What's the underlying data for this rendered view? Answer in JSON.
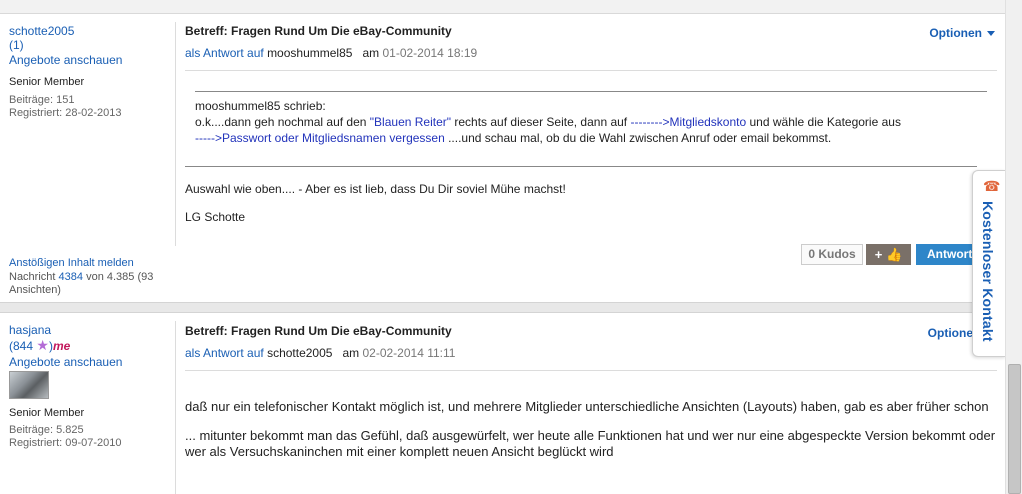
{
  "post1": {
    "author": {
      "username": "schotte2005",
      "rank": "(1)",
      "offers_link": "Angebote anschauen",
      "role": "Senior Member",
      "posts": "Beiträge: 151",
      "registered": "Registriert: 28-02-2013"
    },
    "subject": "Betreff: Fragen Rund Um Die eBay-Community",
    "reply_prefix": "als Antwort auf",
    "reply_to": "mooshummel85",
    "at": "am",
    "date": "01-02-2014 18:19",
    "options_label": "Optionen",
    "quote": {
      "header": "mooshummel85 schrieb:",
      "line1_a": "o.k....dann geh nochmal auf den ",
      "line1_link1": "\"Blauen Reiter\"",
      "line1_b": " rechts auf dieser Seite, dann auf ",
      "line1_link2": "-------->Mitgliedskonto",
      "line1_c": " und wähle die Kategorie aus",
      "line2_link": "----->Passwort oder Mitgliedsnamen vergessen",
      "line2_b": " ....und schau mal, ob du  die Wahl zwischen Anruf oder email bekommst."
    },
    "body": [
      "Auswahl wie oben....  - Aber es ist lieb, dass Du Dir soviel Mühe machst!",
      "LG Schotte"
    ],
    "footer": {
      "report": "Anstößigen Inhalt melden",
      "message_prefix": "Nachricht",
      "message_number": "4384",
      "message_suffix": "von 4.385 (93 Ansichten)"
    },
    "kudos_count": "0 Kudos",
    "kudos_plus": "+",
    "reply_label": "Antwort"
  },
  "post2": {
    "author": {
      "username": "hasjana",
      "rank_open": "(",
      "rank_link": "844",
      "rank_badge": "me",
      "offers_link": "Angebote anschauen",
      "role": "Senior Member",
      "posts": "Beiträge: 5.825",
      "registered": "Registriert: 09-07-2010"
    },
    "subject": "Betreff: Fragen Rund Um Die eBay-Community",
    "reply_prefix": "als Antwort auf",
    "reply_to": "schotte2005",
    "at": "am",
    "date": "02-02-2014 11:11",
    "options_label": "Optione",
    "body": [
      "daß nur ein telefonischer Kontakt möglich ist, und mehrere Mitglieder unterschiedliche Ansichten (Layouts) haben, gab es aber früher schon",
      "... mitunter bekommt man das Gefühl, daß ausgewürfelt, wer heute alle Funktionen hat und wer nur eine abgespeckte Version bekommt oder wer als Versuchskaninchen mit einer komplett neuen Ansicht beglückt wird"
    ]
  },
  "contact_tab": {
    "label": "Kostenloser Kontakt",
    "icon": "phone-icon"
  },
  "colors": {
    "link": "#1a5fb4",
    "reply_button": "#2e86c9",
    "kudos_button": "#7a7068",
    "phone_icon": "#e0653a"
  }
}
